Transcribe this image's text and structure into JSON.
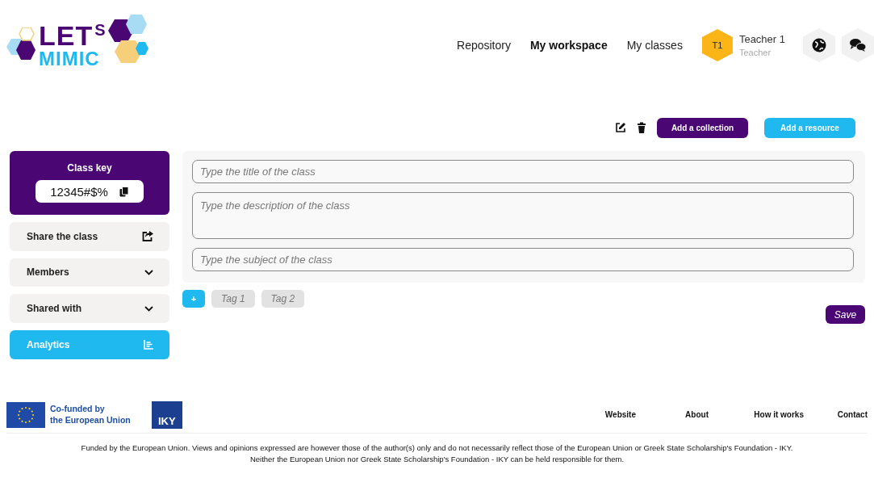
{
  "logo": {
    "word_top": "LET",
    "word_s": "S",
    "word_bottom": "MIMIC"
  },
  "nav": [
    {
      "label": "Repository",
      "selected": false
    },
    {
      "label": "My workspace",
      "selected": true
    },
    {
      "label": "My classes",
      "selected": false
    }
  ],
  "user": {
    "initials": "T1",
    "name": "Teacher 1",
    "role": "Teacher"
  },
  "toolbar": {
    "buttons": [
      {
        "label": "Add a collection",
        "kind": "primary"
      },
      {
        "label": "Add a resource",
        "kind": "secondary"
      }
    ]
  },
  "class_key": {
    "title": "Class key",
    "value": "12345#$%"
  },
  "sidebar": [
    {
      "label": "Share the class",
      "kind": "share",
      "selected": false
    },
    {
      "label": "Members",
      "kind": "accordion",
      "selected": false
    },
    {
      "label": "Shared with",
      "kind": "accordion",
      "selected": false
    },
    {
      "label": "Analytics",
      "kind": "analytics",
      "selected": true
    }
  ],
  "form": {
    "fields": [
      {
        "placeholder": "Type the title of the class",
        "kind": "line"
      },
      {
        "placeholder": "Type the description of the class",
        "kind": "area"
      },
      {
        "placeholder": "Type the subject of the class",
        "kind": "line"
      }
    ]
  },
  "tags": {
    "add": "+",
    "items": [
      "Tag 1",
      "Tag 2"
    ]
  },
  "save": "Save",
  "footer": {
    "eu_line1": "Co-funded by",
    "eu_line2": "the European Union",
    "iky": "IKY",
    "links": [
      "Website",
      "About",
      "How it works",
      "Contact"
    ],
    "disclaimer": [
      "Funded by the European Union. Views and opinions expressed are however those of the author(s) only and do not necessarily reflect those of the European Union or Greek State Scholarship's Foundation - IKY.",
      "Neither the European Union nor Greek State Scholarship's Foundation - IKY can be held responsible for them."
    ]
  }
}
